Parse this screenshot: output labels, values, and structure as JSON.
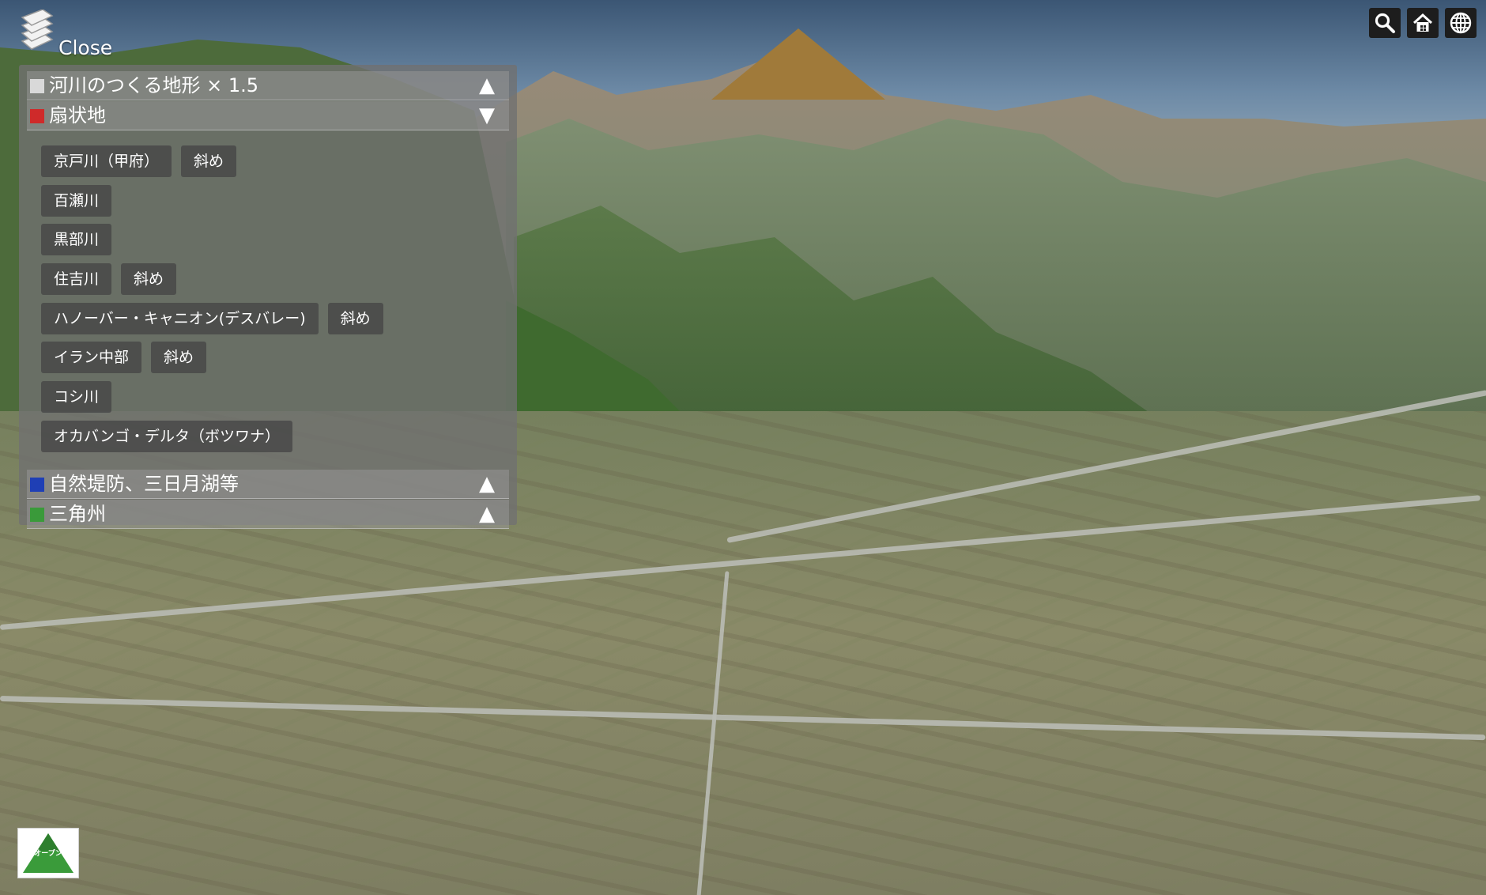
{
  "header": {
    "close_label": "Close"
  },
  "panel": {
    "categories": [
      {
        "label": "河川のつくる地形 × 1.5",
        "swatch": "#d9d9d9",
        "arrow": "▲"
      },
      {
        "label": "扇状地",
        "swatch": "#cf2a2a",
        "arrow": "▼"
      },
      {
        "label": "自然堤防、三日月湖等",
        "swatch": "#1f3fb5",
        "arrow": "▲"
      },
      {
        "label": "三角州",
        "swatch": "#3a9a3a",
        "arrow": "▲"
      }
    ],
    "fan_buttons": [
      {
        "label": "京戸川（甲府）",
        "secondary": "斜め"
      },
      {
        "label": "百瀬川"
      },
      {
        "label": "黒部川"
      },
      {
        "label": "住吉川",
        "secondary": "斜め"
      },
      {
        "label": "ハノーバー・キャニオン(デスバレー)",
        "secondary": "斜め"
      },
      {
        "label": "イラン中部",
        "secondary": "斜め"
      },
      {
        "label": "コシ川"
      },
      {
        "label": "オカバンゴ・デルタ（ボツワナ）"
      }
    ]
  },
  "tools": [
    {
      "name": "search-icon"
    },
    {
      "name": "home-icon"
    },
    {
      "name": "globe-icon"
    }
  ],
  "logo": {
    "text": "オープン",
    "color": "#3a9b3a"
  }
}
